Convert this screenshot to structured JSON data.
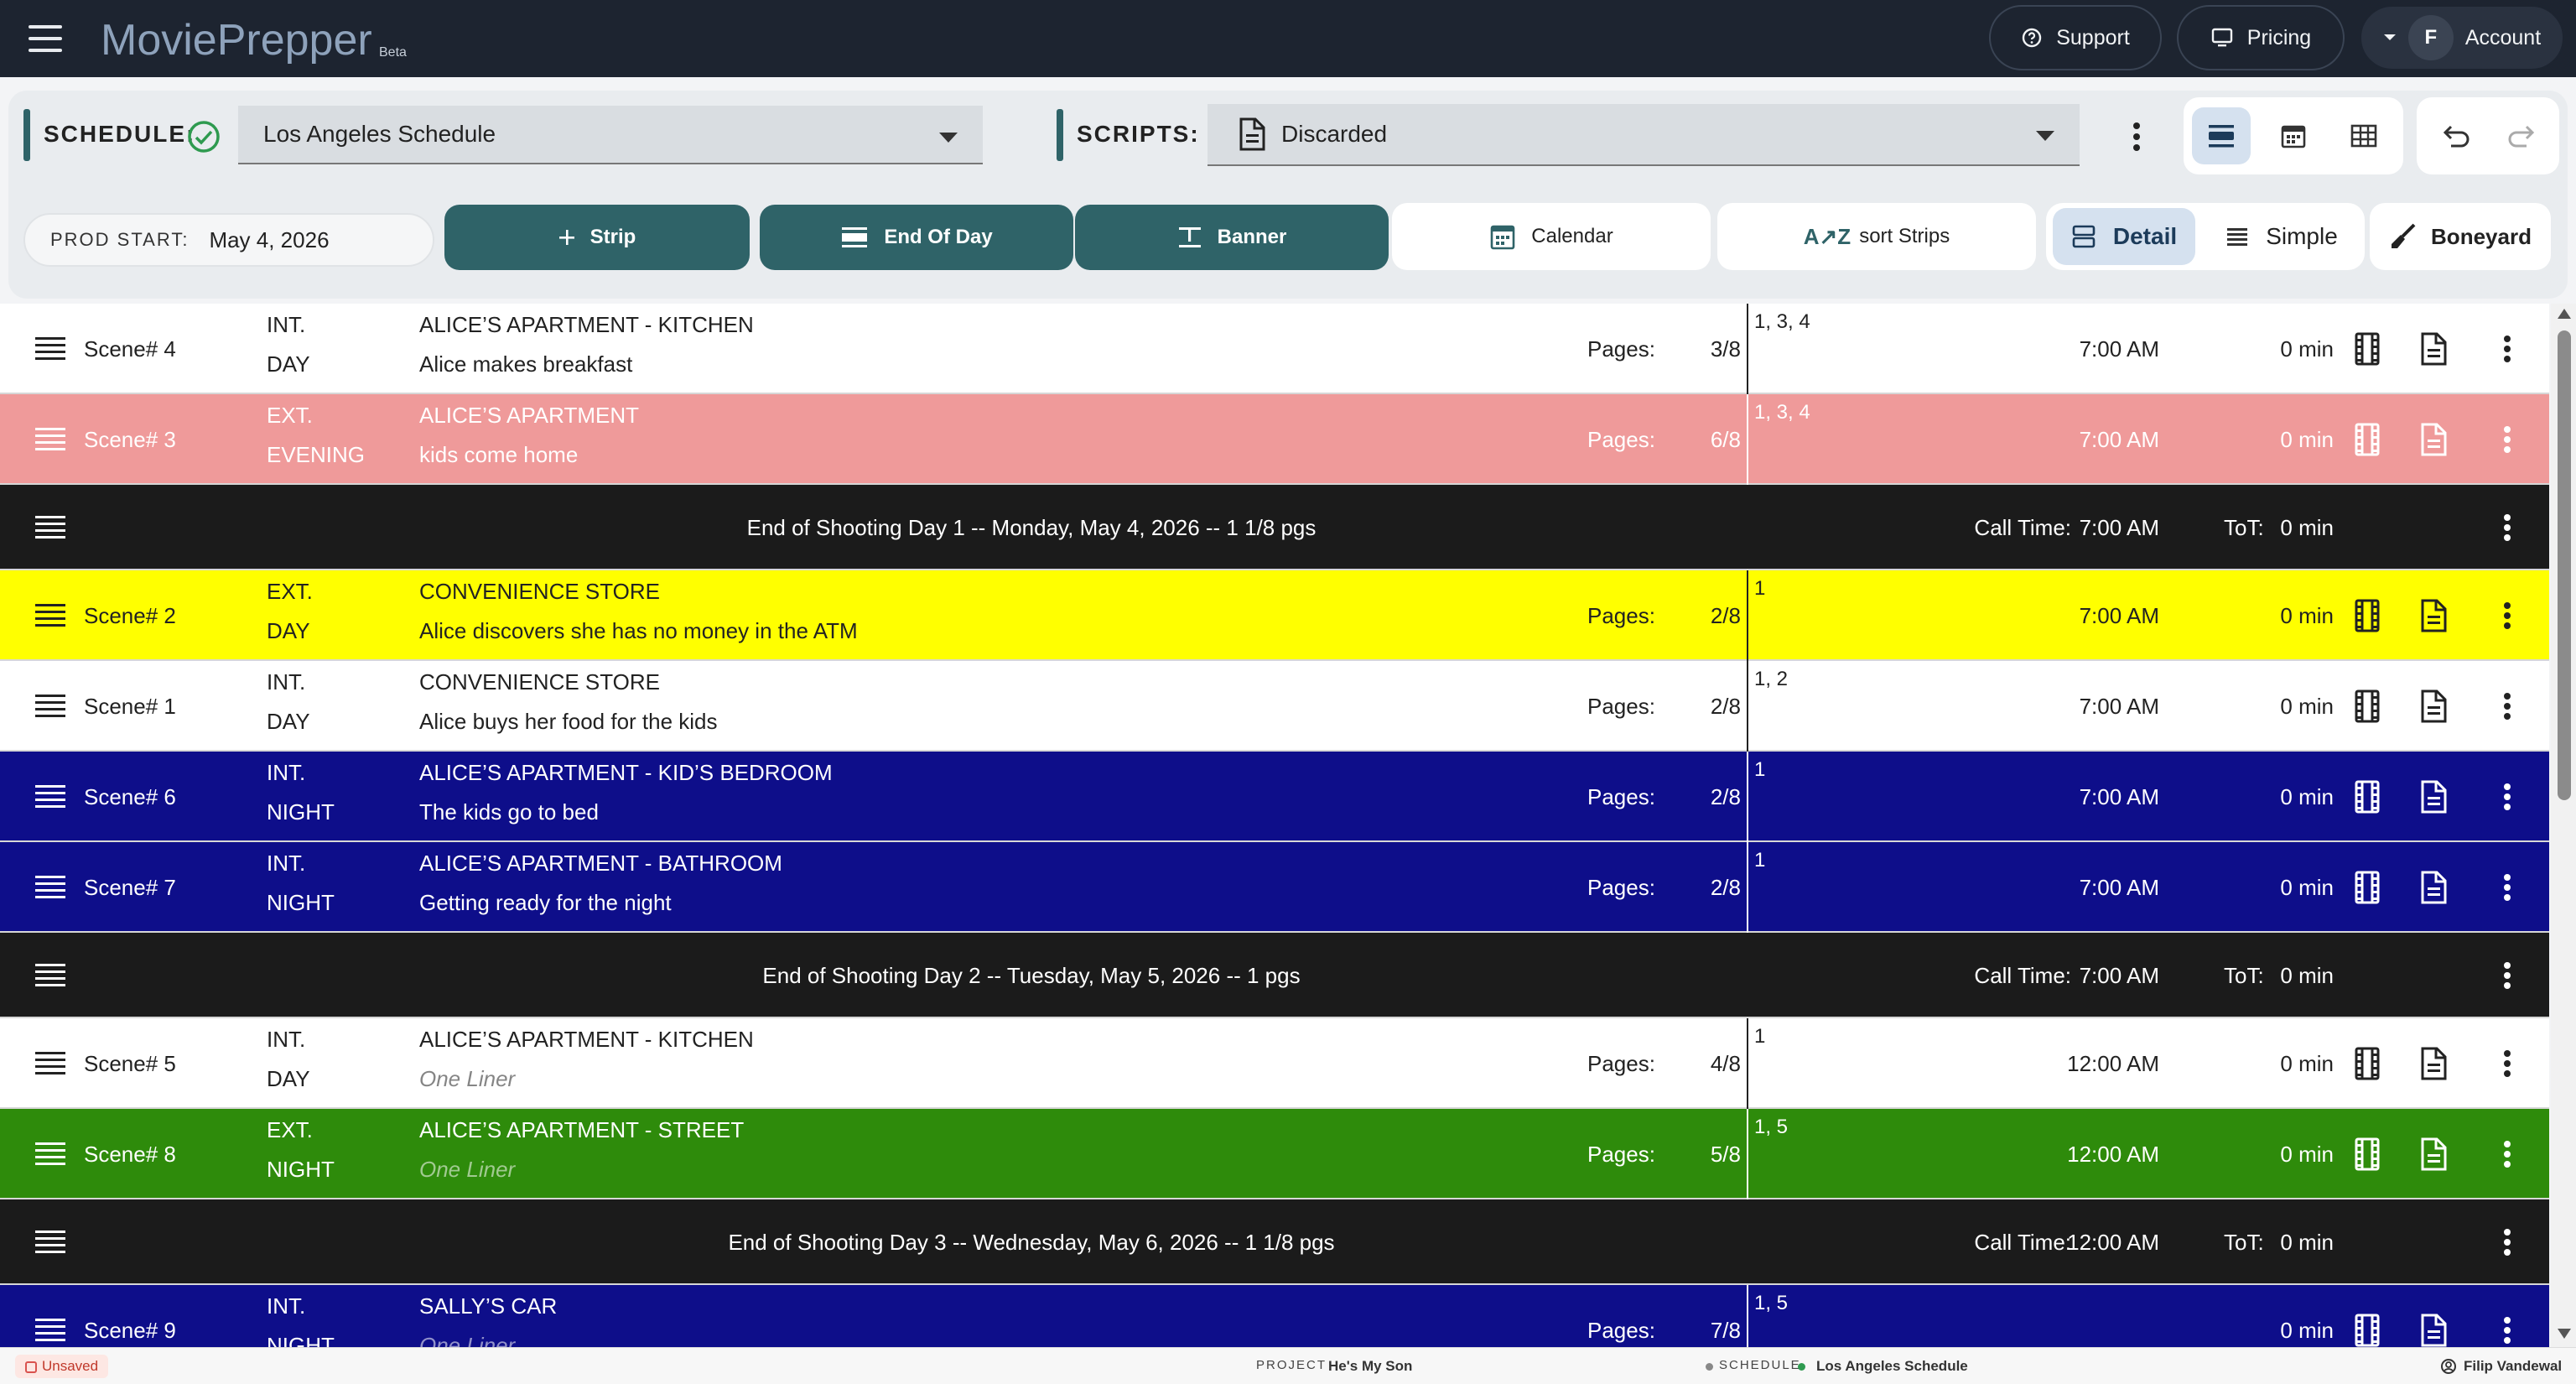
{
  "nav": {
    "logo_text": "MoviePrepper",
    "logo_beta": "Beta",
    "support_label": "Support",
    "pricing_label": "Pricing",
    "account_initial": "F",
    "account_label": "Account"
  },
  "toolbar": {
    "schedule_label": "SCHEDULE:",
    "schedule_value": "Los Angeles Schedule",
    "scripts_label": "SCRIPTS:",
    "scripts_value": "Discarded",
    "prod_start_label": "PROD START:",
    "prod_start_value": "May 4, 2026",
    "strip_label": "Strip",
    "end_of_day_label": "End Of Day",
    "banner_label": "Banner",
    "calendar_label": "Calendar",
    "sort_label": "sort Strips",
    "detail_label": "Detail",
    "simple_label": "Simple",
    "boneyard_label": "Boneyard"
  },
  "board": {
    "pages_label": "Pages:",
    "call_time_label": "Call Time:",
    "tot_label": "ToT:",
    "strips": [
      {
        "type": "scene",
        "scene": "Scene# 4",
        "ie": "INT.",
        "dn": "DAY",
        "location": "ALICE’S APARTMENT - KITCHEN",
        "description": "Alice makes breakfast",
        "placeholder": false,
        "pages": "3/8",
        "cast": "1, 3, 4",
        "time": "7:00 AM",
        "duration": "0 min",
        "bg": "#ffffff",
        "fg": "#222222"
      },
      {
        "type": "scene",
        "scene": "Scene# 3",
        "ie": "EXT.",
        "dn": "EVENING",
        "location": "ALICE’S APARTMENT",
        "description": "kids come home",
        "placeholder": false,
        "pages": "6/8",
        "cast": "1, 3, 4",
        "time": "7:00 AM",
        "duration": "0 min",
        "bg": "#ef9a9a",
        "fg": "#ffffff"
      },
      {
        "type": "eod",
        "title": "End of Shooting Day 1 -- Monday, May 4, 2026 -- 1 1/8 pgs",
        "call_time": "7:00 AM",
        "tot": "0 min",
        "bg": "#1b1b1b",
        "fg": "#ffffff"
      },
      {
        "type": "scene",
        "scene": "Scene# 2",
        "ie": "EXT.",
        "dn": "DAY",
        "location": "CONVENIENCE STORE",
        "description": "Alice discovers she has no money in the ATM",
        "placeholder": false,
        "pages": "2/8",
        "cast": "1",
        "time": "7:00 AM",
        "duration": "0 min",
        "bg": "#ffff00",
        "fg": "#222222"
      },
      {
        "type": "scene",
        "scene": "Scene# 1",
        "ie": "INT.",
        "dn": "DAY",
        "location": "CONVENIENCE STORE",
        "description": "Alice buys her food for the kids",
        "placeholder": false,
        "pages": "2/8",
        "cast": "1, 2",
        "time": "7:00 AM",
        "duration": "0 min",
        "bg": "#ffffff",
        "fg": "#222222"
      },
      {
        "type": "scene",
        "scene": "Scene# 6",
        "ie": "INT.",
        "dn": "NIGHT",
        "location": "ALICE’S APARTMENT - KID’S BEDROOM",
        "description": "The kids go to bed",
        "placeholder": false,
        "pages": "2/8",
        "cast": "1",
        "time": "7:00 AM",
        "duration": "0 min",
        "bg": "#0e0e8a",
        "fg": "#ffffff"
      },
      {
        "type": "scene",
        "scene": "Scene# 7",
        "ie": "INT.",
        "dn": "NIGHT",
        "location": "ALICE’S APARTMENT - BATHROOM",
        "description": "Getting ready for the night",
        "placeholder": false,
        "pages": "2/8",
        "cast": "1",
        "time": "7:00 AM",
        "duration": "0 min",
        "bg": "#0e0e8a",
        "fg": "#ffffff"
      },
      {
        "type": "eod",
        "title": "End of Shooting Day 2 -- Tuesday, May 5, 2026 -- 1 pgs",
        "call_time": "7:00 AM",
        "tot": "0 min",
        "bg": "#1b1b1b",
        "fg": "#ffffff"
      },
      {
        "type": "scene",
        "scene": "Scene# 5",
        "ie": "INT.",
        "dn": "DAY",
        "location": "ALICE’S APARTMENT - KITCHEN",
        "description": "One Liner",
        "placeholder": true,
        "pages": "4/8",
        "cast": "1",
        "time": "12:00 AM",
        "duration": "0 min",
        "bg": "#ffffff",
        "fg": "#222222"
      },
      {
        "type": "scene",
        "scene": "Scene# 8",
        "ie": "EXT.",
        "dn": "NIGHT",
        "location": "ALICE’S APARTMENT - STREET",
        "description": "One Liner",
        "placeholder": true,
        "pages": "5/8",
        "cast": "1, 5",
        "time": "12:00 AM",
        "duration": "0 min",
        "bg": "#2e8b0b",
        "fg": "#ffffff"
      },
      {
        "type": "eod",
        "title": "End of Shooting Day 3 -- Wednesday, May 6, 2026 -- 1 1/8 pgs",
        "call_time": "12:00 AM",
        "tot": "0 min",
        "bg": "#1b1b1b",
        "fg": "#ffffff"
      },
      {
        "type": "scene",
        "scene": "Scene# 9",
        "ie": "INT.",
        "dn": "NIGHT",
        "location": "SALLY’S CAR",
        "description": "One Liner",
        "placeholder": true,
        "pages": "7/8",
        "cast": "1, 5",
        "time": "",
        "duration": "0 min",
        "bg": "#0e0e8a",
        "fg": "#ffffff"
      }
    ]
  },
  "status": {
    "unsaved_label": "Unsaved",
    "project_key": "PROJECT",
    "project_value": "He's My Son",
    "schedule_key": "SCHEDULE",
    "schedule_value": "Los Angeles Schedule",
    "user_name": "Filip Vandewal"
  },
  "colors": {
    "topbar": "#1d2430",
    "accent": "#2f6368",
    "eod_strip": "#1b1b1b"
  },
  "icons": [
    "menu-icon",
    "help-circle-icon",
    "monitor-icon",
    "chevron-down-icon",
    "check-circle-icon",
    "document-icon",
    "more-vertical-icon",
    "strip-view-icon",
    "calendar-icon",
    "grid-icon",
    "undo-icon",
    "redo-icon",
    "plus-icon",
    "end-of-day-icon",
    "banner-icon",
    "sort-az-icon",
    "detail-icon",
    "list-icon",
    "broom-icon",
    "drag-handle-icon",
    "film-icon"
  ]
}
